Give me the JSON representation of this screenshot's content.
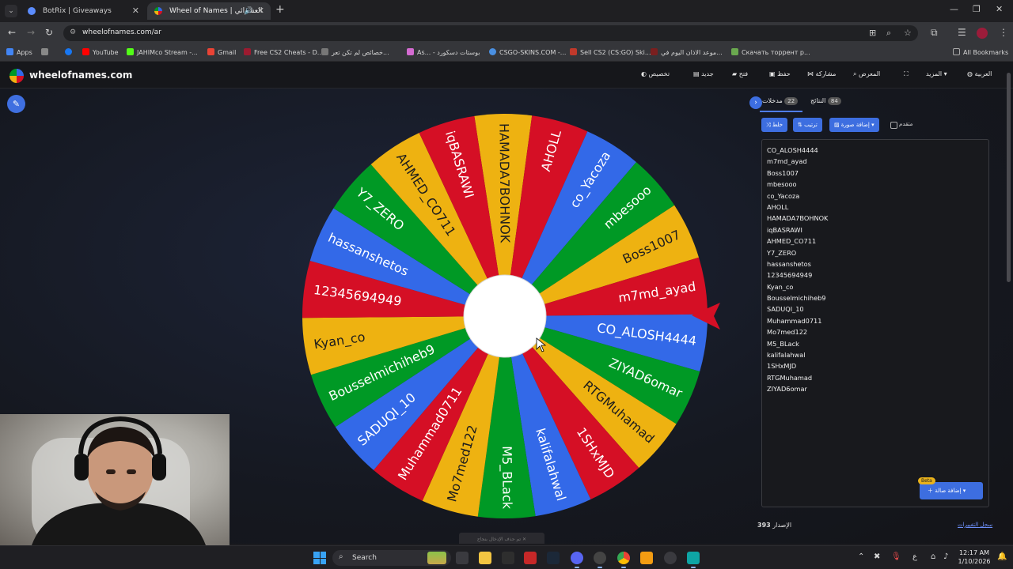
{
  "browser": {
    "tabs": [
      {
        "title": "BotRix | Giveaways",
        "active": false
      },
      {
        "title": "Wheel of Names | العشوائي",
        "active": true
      }
    ],
    "url": "wheelofnames.com/ar",
    "bookmarks": [
      {
        "label": "Apps",
        "color": "#4285f4"
      },
      {
        "label": "",
        "color": "#888888"
      },
      {
        "label": "",
        "color": "#1877f2"
      },
      {
        "label": "YouTube",
        "color": "#ff0000"
      },
      {
        "label": "JAHIMco Stream -...",
        "color": "#53fc18"
      },
      {
        "label": "Gmail",
        "color": "#ea4335"
      },
      {
        "label": "Free CS2 Cheats - D...",
        "color": "#9b1b30"
      },
      {
        "label": "خصائص لم تكن تعر...",
        "color": "#777777"
      },
      {
        "label": "As... - بوستات دسكورد",
        "color": "#d46bd1"
      },
      {
        "label": "CSGO-SKINS.COM -...",
        "color": "#4a90e2"
      },
      {
        "label": "Sell CS2 (CS:GO) Ski...",
        "color": "#c0392b"
      },
      {
        "label": "موعد الاذان اليوم في...",
        "color": "#7a1f1f"
      },
      {
        "label": "Скачать торрент р...",
        "color": "#6aa84f"
      },
      {
        "label": "All Bookmarks",
        "color": "#aaaaaa"
      }
    ]
  },
  "site": {
    "logo_text": "wheelofnames.com",
    "menu": [
      {
        "label": "تخصيص",
        "icon": "palette-icon"
      },
      {
        "label": "جديد",
        "icon": "new-file-icon"
      },
      {
        "label": "فتح",
        "icon": "folder-icon"
      },
      {
        "label": "حفظ",
        "icon": "save-icon"
      },
      {
        "label": "مشاركة",
        "icon": "share-icon"
      },
      {
        "label": "المعرض",
        "icon": "search-icon"
      },
      {
        "label": "",
        "icon": "fullscreen-icon"
      },
      {
        "label": "المزيد",
        "icon": "chevron-down-icon"
      },
      {
        "label": "العربية",
        "icon": "globe-icon"
      }
    ]
  },
  "panel": {
    "entries_tab": "مدخلات",
    "entries_count": "22",
    "results_tab": "النتائج",
    "results_count": "84",
    "shuffle_label": "خلط",
    "sort_label": "ترتيب",
    "add_image_label": "إضافة صورة",
    "advanced_label": "متقدم",
    "entries": [
      "CO_ALOSH4444",
      "m7md_ayad",
      "Boss1007",
      "mbesooo",
      "co_Yacoza",
      "AHOLL",
      "HAMADA7BOHNOK",
      "iqBASRAWI",
      "AHMED_CO711",
      "Y7_ZERO",
      "hassanshetos",
      "12345694949",
      "Kyan_co",
      "Bousselmichiheb9",
      "SADUQI_10",
      "Muhammad0711",
      "Mo7med122",
      "M5_BLack",
      "kalifalahwal",
      "1SHxMJD",
      "RTGMuhamad",
      "ZIYAD6omar"
    ],
    "add_button_label": "إضافة صالة",
    "beta_label": "Beta",
    "version_label": "الإصدار",
    "version_number": "393",
    "changelog_label": "سجل التغييرات"
  },
  "wheel": {
    "segments": [
      "HAMADA7BOHNOK",
      "AHOLL",
      "co_Yacoza",
      "mbesooo",
      "Boss1007",
      "m7md_ayad",
      "CO_ALOSH4444",
      "ZIYAD6omar",
      "RTGMuhamad",
      "1SHxMJD",
      "kalifalahwal",
      "M5_BLack",
      "Mo7med122",
      "Muhammad0711",
      "SADUQI_10",
      "Bousselmichiheb9",
      "Kyan_co",
      "12345694949",
      "hassanshetos",
      "Y7_ZERO",
      "AHMED_CO711",
      "iqBASRAWI"
    ],
    "colors": [
      "#eeb211",
      "#d50f25",
      "#3369e8",
      "#009925"
    ],
    "pointer_color": "#d50f25"
  },
  "toast_text": "تم حذف الإدخال بنجاح",
  "taskbar": {
    "search_label": "Search",
    "time": "12:17 AM",
    "date": "1/10/2026",
    "lang": "ع"
  }
}
